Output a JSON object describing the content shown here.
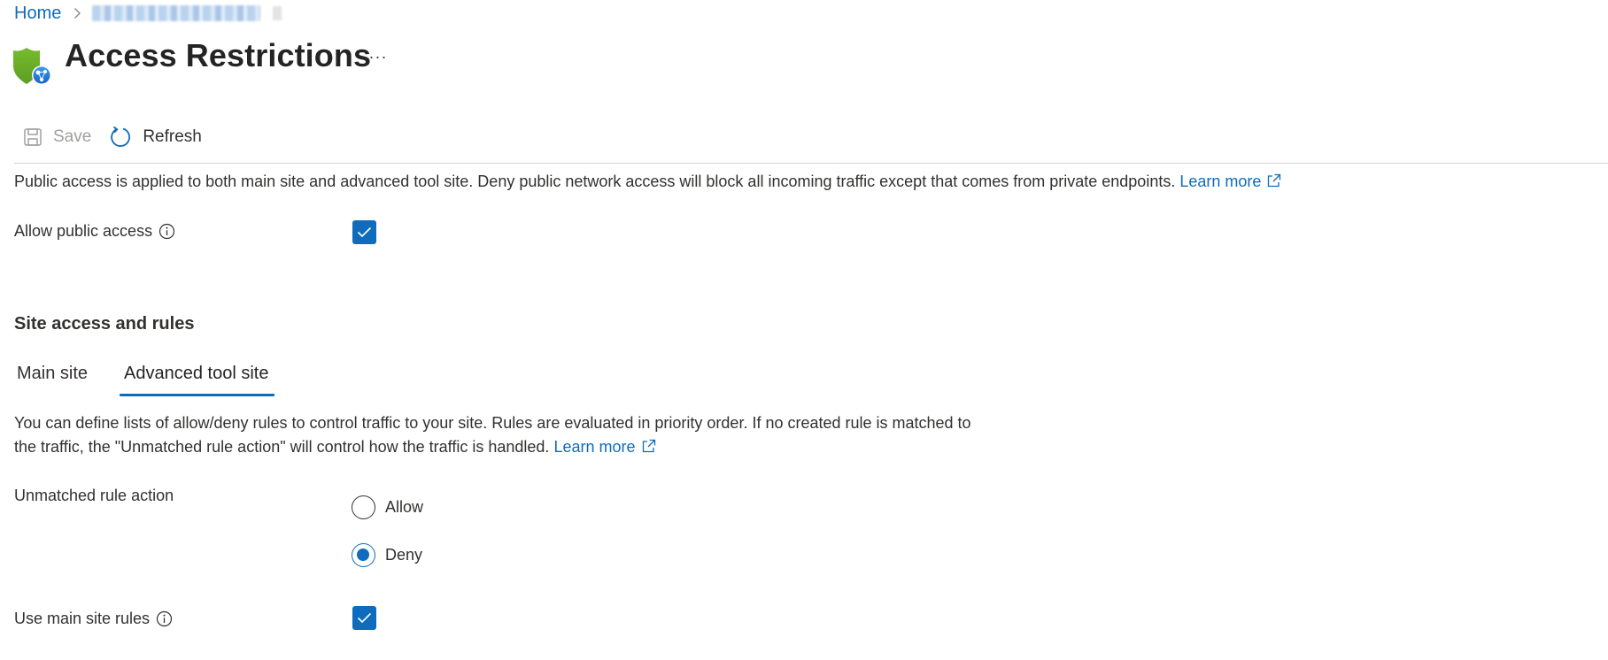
{
  "breadcrumb": {
    "home": "Home",
    "current_redacted": true
  },
  "header": {
    "title": "Access Restrictions",
    "more_label": "···"
  },
  "toolbar": {
    "save_label": "Save",
    "save_disabled": true,
    "refresh_label": "Refresh"
  },
  "public_access": {
    "description": "Public access is applied to both main site and advanced tool site. Deny public network access will block all incoming traffic except that comes from private endpoints.",
    "learn_more": "Learn more",
    "allow_label": "Allow public access",
    "allow_checked": true
  },
  "site_access": {
    "heading": "Site access and rules",
    "tabs": [
      {
        "label": "Main site",
        "active": false
      },
      {
        "label": "Advanced tool site",
        "active": true
      }
    ],
    "description_line1": "You can define lists of allow/deny rules to control traffic to your site. Rules are evaluated in priority order. If no created rule is matched to",
    "description_line2": "the traffic, the \"Unmatched rule action\" will control how the traffic is handled.",
    "learn_more": "Learn more",
    "unmatched_label": "Unmatched rule action",
    "unmatched_options": [
      {
        "label": "Allow",
        "selected": false
      },
      {
        "label": "Deny",
        "selected": true
      }
    ],
    "use_main_rules_label": "Use main site rules",
    "use_main_rules_checked": true
  },
  "colors": {
    "accent": "#0f6cbd",
    "text": "#323130",
    "disabled": "#a19f9d",
    "divider": "#d6d6d6",
    "shield": "#6bb52b"
  }
}
